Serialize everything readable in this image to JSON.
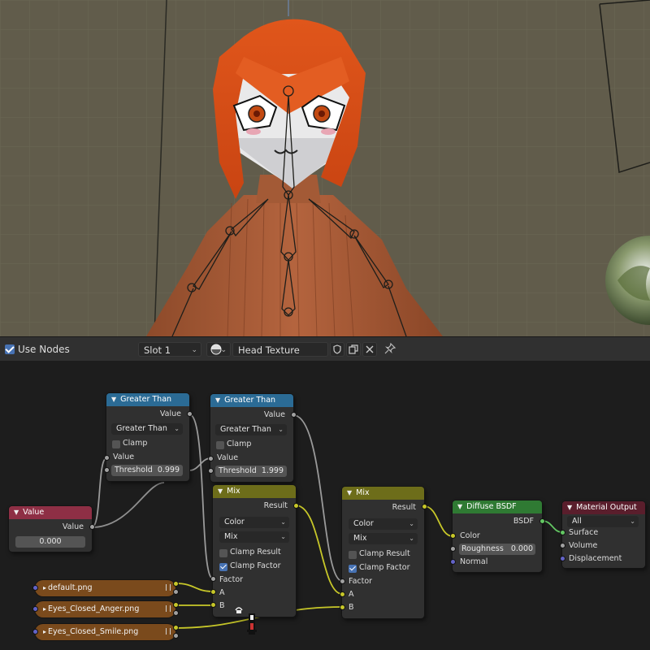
{
  "header": {
    "use_nodes_label": "Use Nodes",
    "use_nodes_checked": true,
    "slot": "Slot 1",
    "material_name": "Head Texture"
  },
  "nodes": {
    "gt1": {
      "title": "Greater Than",
      "output": "Value",
      "operation": "Greater Than",
      "clamp_label": "Clamp",
      "clamp": false,
      "input_label": "Value",
      "threshold_label": "Threshold",
      "threshold_value": "0.999"
    },
    "gt2": {
      "title": "Greater Than",
      "output": "Value",
      "operation": "Greater Than",
      "clamp_label": "Clamp",
      "clamp": false,
      "input_label": "Value",
      "threshold_label": "Threshold",
      "threshold_value": "1.999"
    },
    "value": {
      "title": "Value",
      "output": "Value",
      "value": "0.000"
    },
    "mix1": {
      "title": "Mix",
      "output": "Result",
      "data_type": "Color",
      "blend": "Mix",
      "clamp_result_label": "Clamp Result",
      "clamp_result": false,
      "clamp_factor_label": "Clamp Factor",
      "clamp_factor": true,
      "input_factor": "Factor",
      "input_a": "A",
      "input_b": "B"
    },
    "mix2": {
      "title": "Mix",
      "output": "Result",
      "data_type": "Color",
      "blend": "Mix",
      "clamp_result_label": "Clamp Result",
      "clamp_result": false,
      "clamp_factor_label": "Clamp Factor",
      "clamp_factor": true,
      "input_factor": "Factor",
      "input_a": "A",
      "input_b": "B"
    },
    "diffuse": {
      "title": "Diffuse BSDF",
      "output": "BSDF",
      "input_color": "Color",
      "roughness_label": "Roughness",
      "roughness_value": "0.000",
      "input_normal": "Normal"
    },
    "output": {
      "title": "Material Output",
      "target": "All",
      "input_surface": "Surface",
      "input_volume": "Volume",
      "input_displacement": "Displacement"
    },
    "images": [
      "default.png",
      "Eyes_Closed_Anger.png",
      "Eyes_Closed_Smile.png"
    ]
  },
  "colors": {
    "converter_header": "#2b6b95",
    "input_header": "#8e2f45",
    "mix_header": "#6d6d1a",
    "shader_header": "#2f7a33",
    "output_header": "#5a1e2c",
    "image_node": "#7a4a1c",
    "link_grey": "#9a9a9a",
    "link_yellow": "#c7c729",
    "link_green": "#63c763"
  }
}
